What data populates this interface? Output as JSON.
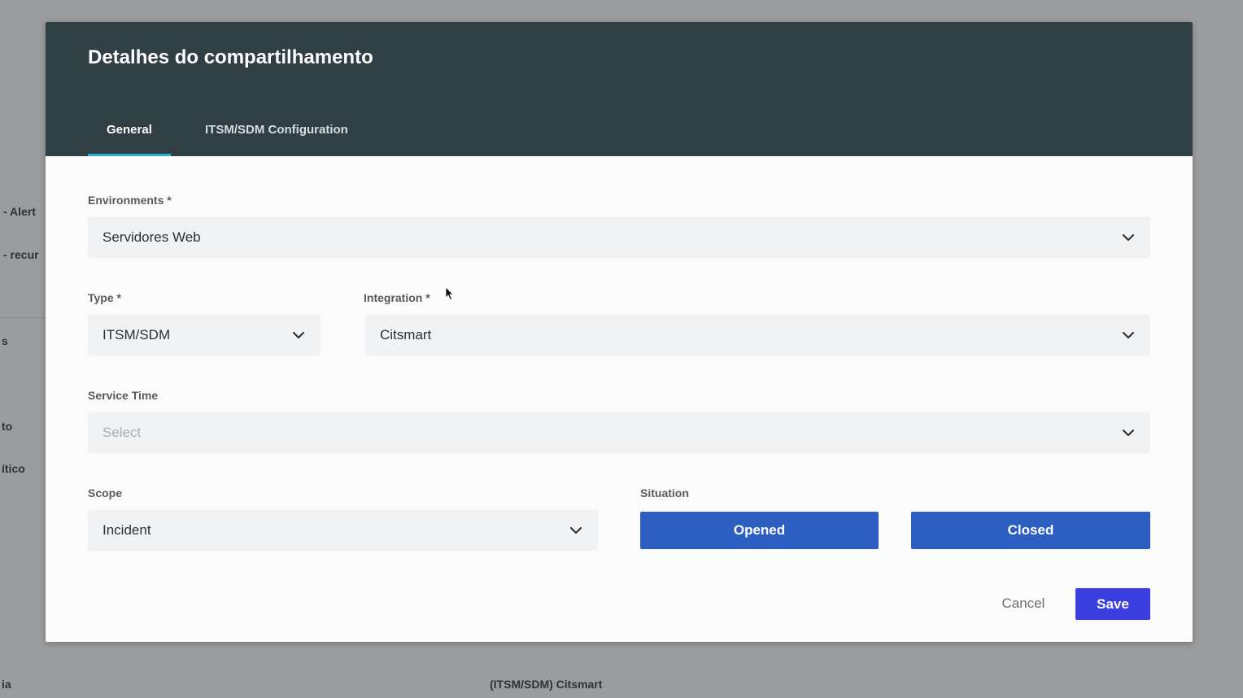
{
  "background": {
    "side_labels": [
      "- Alert",
      "- recur",
      "s",
      "to",
      "ítico",
      "ia"
    ],
    "bottom_row_text": "(ITSM/SDM) Citsmart"
  },
  "modal": {
    "title": "Detalhes do compartilhamento",
    "tabs": [
      {
        "label": "General",
        "active": true
      },
      {
        "label": "ITSM/SDM Configuration",
        "active": false
      }
    ],
    "environments": {
      "label": "Environments *",
      "value": "Servidores Web"
    },
    "type": {
      "label": "Type *",
      "value": "ITSM/SDM"
    },
    "integration": {
      "label": "Integration *",
      "value": "Citsmart"
    },
    "service_time": {
      "label": "Service Time",
      "placeholder": "Select"
    },
    "scope": {
      "label": "Scope",
      "value": "Incident"
    },
    "situation": {
      "label": "Situation",
      "buttons": [
        "Opened",
        "Closed"
      ]
    },
    "footer": {
      "cancel_label": "Cancel",
      "save_label": "Save"
    }
  },
  "colors": {
    "header_bg": "#2f3f43",
    "tab_underline": "#2fb0c9",
    "situation_button": "#2d5fc3",
    "save_button": "#3b3fe0"
  },
  "icons": [
    "chevron-down-icon",
    "mouse-cursor-icon"
  ]
}
